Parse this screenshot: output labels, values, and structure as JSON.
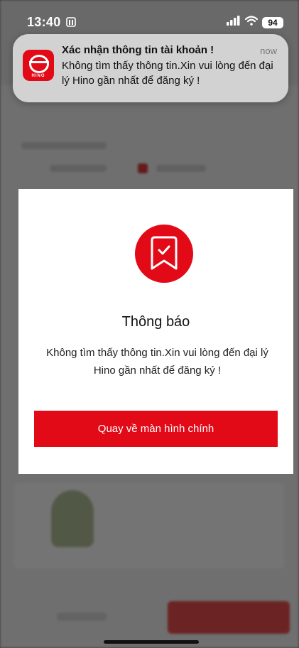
{
  "status_bar": {
    "time": "13:40",
    "battery": "94",
    "icons": [
      "sim-icon",
      "signal-icon",
      "wifi-icon",
      "battery-icon"
    ]
  },
  "notification": {
    "title": "Xác nhận thông tin tài khoản !",
    "time": "now",
    "body": "Không tìm thấy thông tin.Xin vui lòng đến đại lý Hino gần nhất để đăng ký !",
    "app_icon_text": "HINO",
    "app_icon": "hino-app-icon"
  },
  "dialog": {
    "icon": "bookmark-check-icon",
    "title": "Thông báo",
    "message": "Không tìm thấy thông tin.Xin vui lòng đến đại lý Hino gần nhất để đăng ký !",
    "button_label": "Quay về màn hình chính"
  },
  "colors": {
    "accent": "#e30a18",
    "overlay": "rgba(0,0,0,0.52)"
  }
}
